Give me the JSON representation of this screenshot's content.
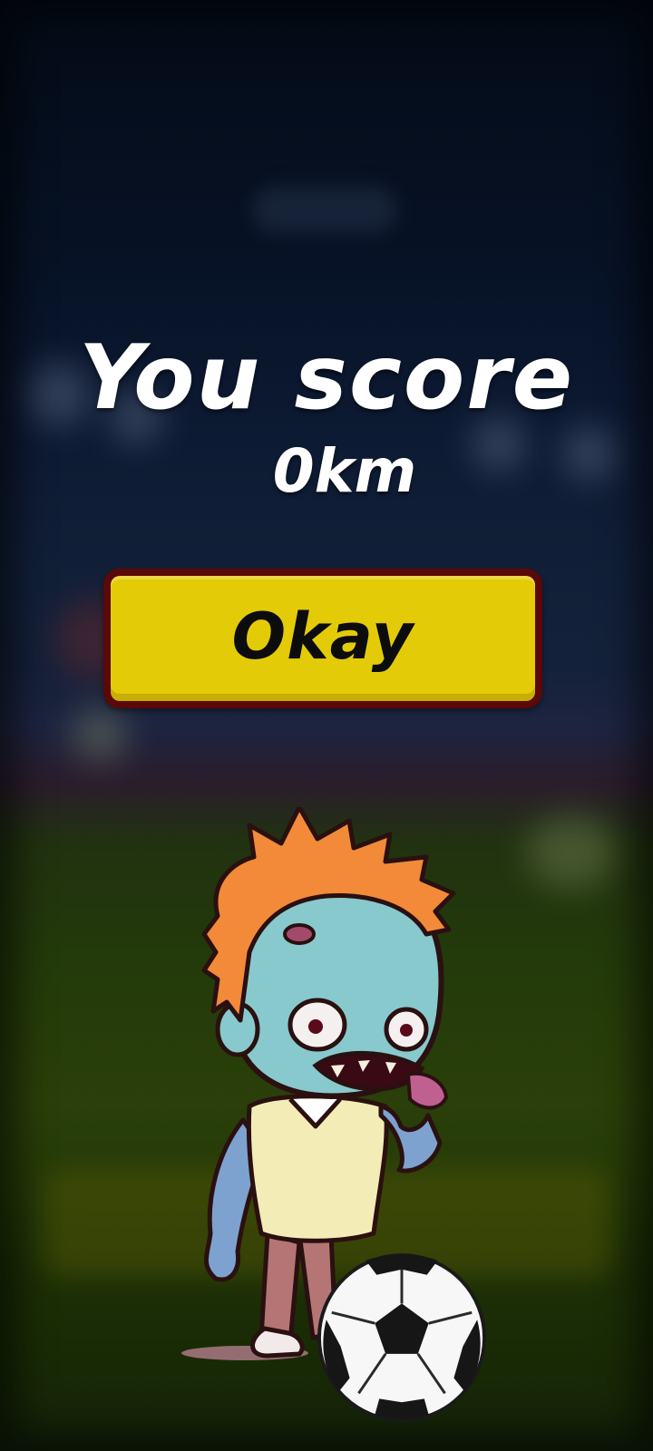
{
  "popup": {
    "title": "You score",
    "score_value": "0km",
    "okay_label": "Okay"
  },
  "colors": {
    "button_fill": "#e3cb08",
    "button_border": "#5a0808",
    "text": "#ffffff"
  },
  "icons": {
    "character": "zombie-boy-icon",
    "ball": "soccer-ball-icon"
  }
}
